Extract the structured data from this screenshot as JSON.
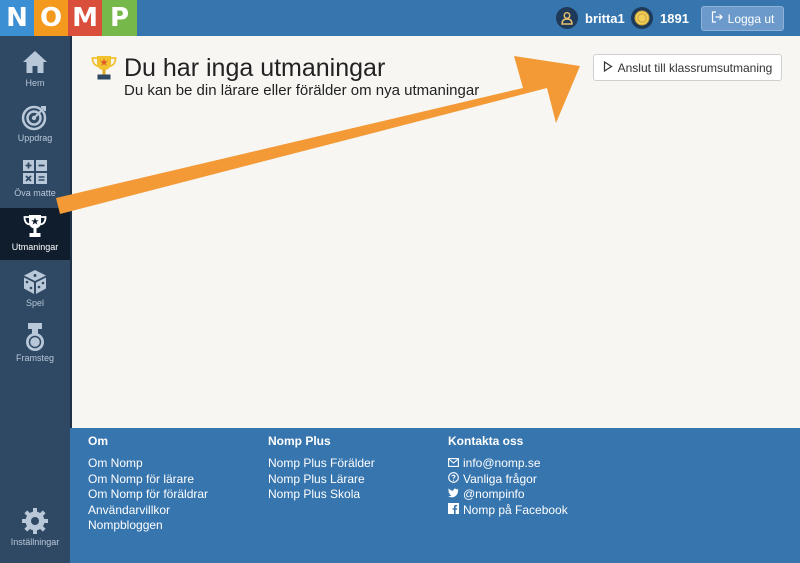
{
  "logo": {
    "letters": [
      "N",
      "O",
      "M",
      "P"
    ]
  },
  "topbar": {
    "username": "britta1",
    "coins": "1891",
    "logout_label": "Logga ut"
  },
  "sidebar": {
    "items": [
      {
        "label": "Hem",
        "icon": "home-icon"
      },
      {
        "label": "Uppdrag",
        "icon": "target-icon"
      },
      {
        "label": "Öva matte",
        "icon": "calculator-icon"
      },
      {
        "label": "Utmaningar",
        "icon": "trophy-icon",
        "active": true
      },
      {
        "label": "Spel",
        "icon": "dice-icon"
      },
      {
        "label": "Framsteg",
        "icon": "medal-icon"
      }
    ],
    "settings_label": "Inställningar"
  },
  "main": {
    "title": "Du har inga utmaningar",
    "subtitle": "Du kan be din lärare eller förälder om nya utmaningar",
    "join_button_label": "Anslut till klassrumsutmaning"
  },
  "footer": {
    "columns": [
      {
        "title": "Om",
        "links": [
          "Om Nomp",
          "Om Nomp för lärare",
          "Om Nomp för föräldrar",
          "Användarvillkor",
          "Nompbloggen"
        ]
      },
      {
        "title": "Nomp Plus",
        "links": [
          "Nomp Plus Förälder",
          "Nomp Plus Lärare",
          "Nomp Plus Skola"
        ]
      },
      {
        "title": "Kontakta oss",
        "links": [
          "info@nomp.se",
          "Vanliga frågor",
          "@nompinfo",
          "Nomp på Facebook"
        ]
      }
    ]
  },
  "colors": {
    "topbar": "#3675ae",
    "sidebar": "#2f4863",
    "sidebar_active": "#0f1d2c",
    "arrow": "#f39a36",
    "background": "#f7f6f2"
  }
}
